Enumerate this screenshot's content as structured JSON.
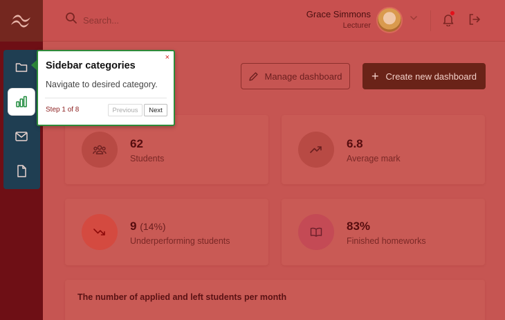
{
  "app": {
    "logo_icon": "tailwind-wave-icon"
  },
  "sidebar": {
    "items": [
      {
        "name": "folder",
        "icon": "folder-icon"
      },
      {
        "name": "analytics",
        "icon": "bar-chart-icon",
        "active": true
      },
      {
        "name": "mail",
        "icon": "mail-icon"
      },
      {
        "name": "documents",
        "icon": "file-icon"
      }
    ]
  },
  "header": {
    "search": {
      "placeholder": "Search...",
      "value": ""
    },
    "user": {
      "name": "Grace Simmons",
      "role": "Lecturer"
    },
    "notifications": {
      "has_unread": true
    }
  },
  "toolbar": {
    "manage_label": "Manage dashboard",
    "create_label": "Create new dashboard"
  },
  "stats": [
    {
      "value": "62",
      "extra": "",
      "label": "Students",
      "icon": "users-icon"
    },
    {
      "value": "6.8",
      "extra": "",
      "label": "Average mark",
      "icon": "trending-up-icon"
    },
    {
      "value": "9",
      "extra": "(14%)",
      "label": "Underperforming students",
      "icon": "trending-down-icon"
    },
    {
      "value": "83%",
      "extra": "",
      "label": "Finished homeworks",
      "icon": "book-icon"
    }
  ],
  "chart_panel": {
    "title": "The number of applied and left students per month"
  },
  "tour": {
    "close_label": "×",
    "title": "Sidebar categories",
    "body": "Navigate to desired category.",
    "step": "Step 1 of 8",
    "prev_label": "Previous",
    "next_label": "Next"
  },
  "colors": {
    "overlay": "#c8504f",
    "sidebar": "#6e0f15",
    "nav_panel": "#1f3e52",
    "tour_border": "#2e8b3a",
    "create_button": "#6a2318"
  }
}
